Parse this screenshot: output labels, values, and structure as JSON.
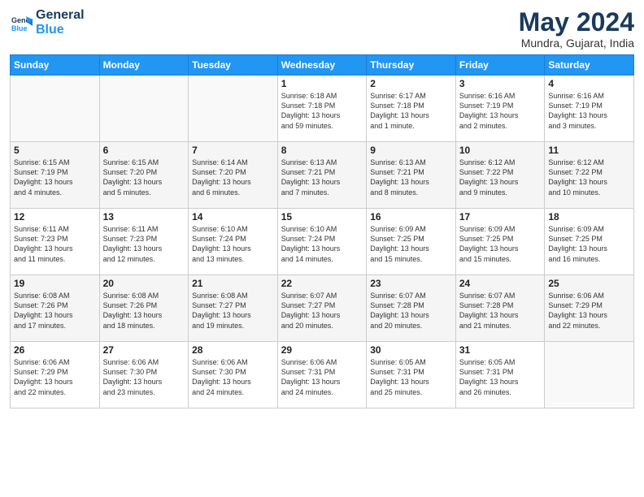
{
  "header": {
    "logo_line1": "General",
    "logo_line2": "Blue",
    "month": "May 2024",
    "location": "Mundra, Gujarat, India"
  },
  "weekdays": [
    "Sunday",
    "Monday",
    "Tuesday",
    "Wednesday",
    "Thursday",
    "Friday",
    "Saturday"
  ],
  "weeks": [
    [
      {
        "day": "",
        "info": ""
      },
      {
        "day": "",
        "info": ""
      },
      {
        "day": "",
        "info": ""
      },
      {
        "day": "1",
        "info": "Sunrise: 6:18 AM\nSunset: 7:18 PM\nDaylight: 13 hours\nand 59 minutes."
      },
      {
        "day": "2",
        "info": "Sunrise: 6:17 AM\nSunset: 7:18 PM\nDaylight: 13 hours\nand 1 minute."
      },
      {
        "day": "3",
        "info": "Sunrise: 6:16 AM\nSunset: 7:19 PM\nDaylight: 13 hours\nand 2 minutes."
      },
      {
        "day": "4",
        "info": "Sunrise: 6:16 AM\nSunset: 7:19 PM\nDaylight: 13 hours\nand 3 minutes."
      }
    ],
    [
      {
        "day": "5",
        "info": "Sunrise: 6:15 AM\nSunset: 7:19 PM\nDaylight: 13 hours\nand 4 minutes."
      },
      {
        "day": "6",
        "info": "Sunrise: 6:15 AM\nSunset: 7:20 PM\nDaylight: 13 hours\nand 5 minutes."
      },
      {
        "day": "7",
        "info": "Sunrise: 6:14 AM\nSunset: 7:20 PM\nDaylight: 13 hours\nand 6 minutes."
      },
      {
        "day": "8",
        "info": "Sunrise: 6:13 AM\nSunset: 7:21 PM\nDaylight: 13 hours\nand 7 minutes."
      },
      {
        "day": "9",
        "info": "Sunrise: 6:13 AM\nSunset: 7:21 PM\nDaylight: 13 hours\nand 8 minutes."
      },
      {
        "day": "10",
        "info": "Sunrise: 6:12 AM\nSunset: 7:22 PM\nDaylight: 13 hours\nand 9 minutes."
      },
      {
        "day": "11",
        "info": "Sunrise: 6:12 AM\nSunset: 7:22 PM\nDaylight: 13 hours\nand 10 minutes."
      }
    ],
    [
      {
        "day": "12",
        "info": "Sunrise: 6:11 AM\nSunset: 7:23 PM\nDaylight: 13 hours\nand 11 minutes."
      },
      {
        "day": "13",
        "info": "Sunrise: 6:11 AM\nSunset: 7:23 PM\nDaylight: 13 hours\nand 12 minutes."
      },
      {
        "day": "14",
        "info": "Sunrise: 6:10 AM\nSunset: 7:24 PM\nDaylight: 13 hours\nand 13 minutes."
      },
      {
        "day": "15",
        "info": "Sunrise: 6:10 AM\nSunset: 7:24 PM\nDaylight: 13 hours\nand 14 minutes."
      },
      {
        "day": "16",
        "info": "Sunrise: 6:09 AM\nSunset: 7:25 PM\nDaylight: 13 hours\nand 15 minutes."
      },
      {
        "day": "17",
        "info": "Sunrise: 6:09 AM\nSunset: 7:25 PM\nDaylight: 13 hours\nand 15 minutes."
      },
      {
        "day": "18",
        "info": "Sunrise: 6:09 AM\nSunset: 7:25 PM\nDaylight: 13 hours\nand 16 minutes."
      }
    ],
    [
      {
        "day": "19",
        "info": "Sunrise: 6:08 AM\nSunset: 7:26 PM\nDaylight: 13 hours\nand 17 minutes."
      },
      {
        "day": "20",
        "info": "Sunrise: 6:08 AM\nSunset: 7:26 PM\nDaylight: 13 hours\nand 18 minutes."
      },
      {
        "day": "21",
        "info": "Sunrise: 6:08 AM\nSunset: 7:27 PM\nDaylight: 13 hours\nand 19 minutes."
      },
      {
        "day": "22",
        "info": "Sunrise: 6:07 AM\nSunset: 7:27 PM\nDaylight: 13 hours\nand 20 minutes."
      },
      {
        "day": "23",
        "info": "Sunrise: 6:07 AM\nSunset: 7:28 PM\nDaylight: 13 hours\nand 20 minutes."
      },
      {
        "day": "24",
        "info": "Sunrise: 6:07 AM\nSunset: 7:28 PM\nDaylight: 13 hours\nand 21 minutes."
      },
      {
        "day": "25",
        "info": "Sunrise: 6:06 AM\nSunset: 7:29 PM\nDaylight: 13 hours\nand 22 minutes."
      }
    ],
    [
      {
        "day": "26",
        "info": "Sunrise: 6:06 AM\nSunset: 7:29 PM\nDaylight: 13 hours\nand 22 minutes."
      },
      {
        "day": "27",
        "info": "Sunrise: 6:06 AM\nSunset: 7:30 PM\nDaylight: 13 hours\nand 23 minutes."
      },
      {
        "day": "28",
        "info": "Sunrise: 6:06 AM\nSunset: 7:30 PM\nDaylight: 13 hours\nand 24 minutes."
      },
      {
        "day": "29",
        "info": "Sunrise: 6:06 AM\nSunset: 7:31 PM\nDaylight: 13 hours\nand 24 minutes."
      },
      {
        "day": "30",
        "info": "Sunrise: 6:05 AM\nSunset: 7:31 PM\nDaylight: 13 hours\nand 25 minutes."
      },
      {
        "day": "31",
        "info": "Sunrise: 6:05 AM\nSunset: 7:31 PM\nDaylight: 13 hours\nand 26 minutes."
      },
      {
        "day": "",
        "info": ""
      }
    ]
  ]
}
